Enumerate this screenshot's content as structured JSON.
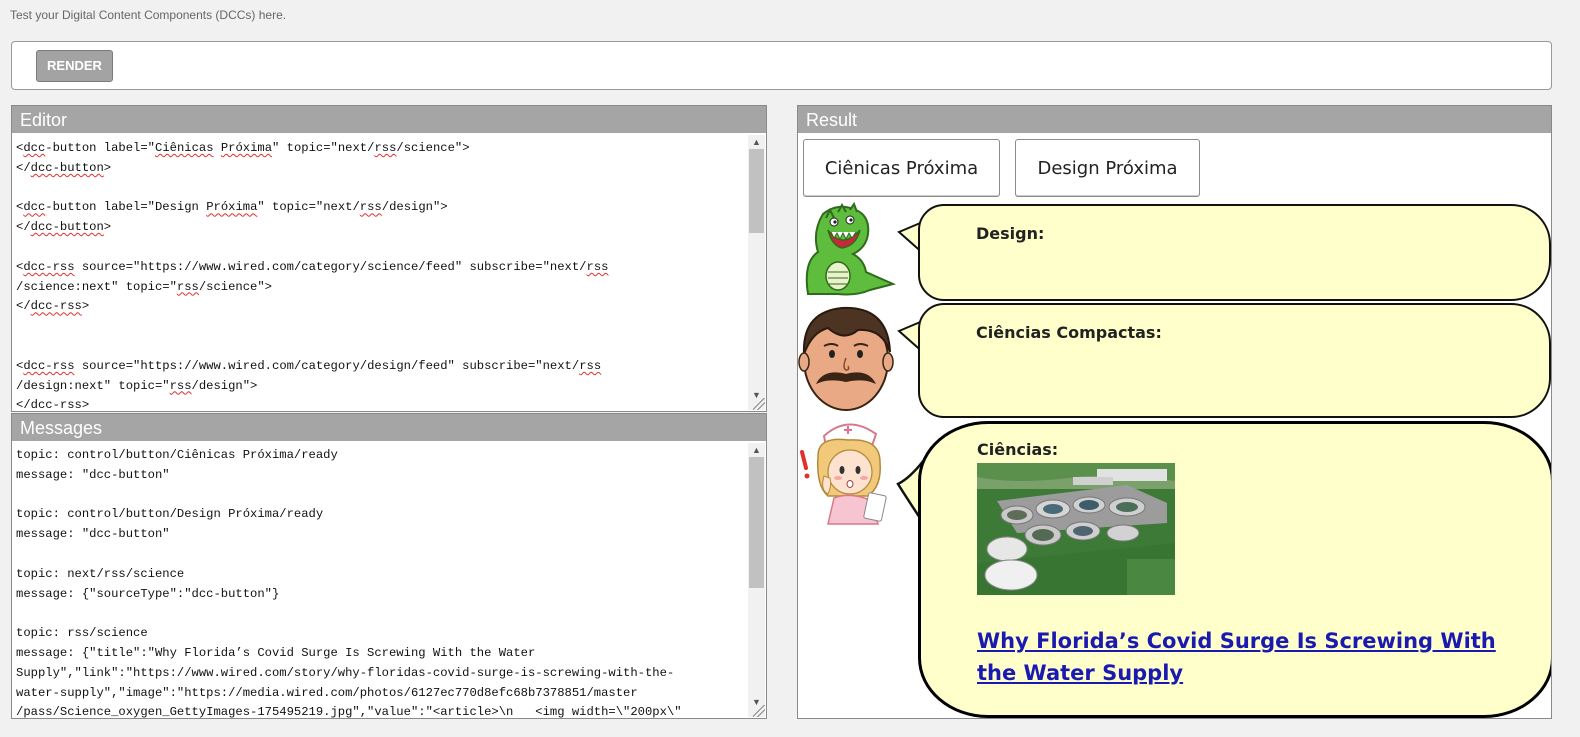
{
  "intro_text": "Test your Digital Content Components (DCCs) here.",
  "toolbar": {
    "render_label": "RENDER"
  },
  "editor": {
    "title": "Editor",
    "lines": [
      [
        {
          "t": "<"
        },
        {
          "t": "dcc",
          "s": 1
        },
        {
          "t": "-button label=\""
        },
        {
          "t": "Ciênicas",
          "s": 1
        },
        {
          "t": " "
        },
        {
          "t": "Próxima",
          "s": 1
        },
        {
          "t": "\" topic=\"next/"
        },
        {
          "t": "rss",
          "s": 1
        },
        {
          "t": "/science\">"
        }
      ],
      [
        {
          "t": "</"
        },
        {
          "t": "dcc-button",
          "s": 1
        },
        {
          "t": ">"
        }
      ],
      [],
      [
        {
          "t": "<"
        },
        {
          "t": "dcc",
          "s": 1
        },
        {
          "t": "-button label=\"Design "
        },
        {
          "t": "Próxima",
          "s": 1
        },
        {
          "t": "\" topic=\"next/"
        },
        {
          "t": "rss",
          "s": 1
        },
        {
          "t": "/design\">"
        }
      ],
      [
        {
          "t": "</"
        },
        {
          "t": "dcc-button",
          "s": 1
        },
        {
          "t": ">"
        }
      ],
      [],
      [
        {
          "t": "<"
        },
        {
          "t": "dcc-rss",
          "s": 1
        },
        {
          "t": " source=\"https://www.wired.com/category/science/feed\" subscribe=\"next/"
        },
        {
          "t": "rss",
          "s": 1
        }
      ],
      [
        {
          "t": "/science:next\" topic=\""
        },
        {
          "t": "rss",
          "s": 1
        },
        {
          "t": "/science\">"
        }
      ],
      [
        {
          "t": "</"
        },
        {
          "t": "dcc-rss",
          "s": 1
        },
        {
          "t": ">"
        }
      ],
      [],
      [],
      [
        {
          "t": "<"
        },
        {
          "t": "dcc-rss",
          "s": 1
        },
        {
          "t": " source=\"https://www.wired.com/category/design/feed\" subscribe=\"next/"
        },
        {
          "t": "rss",
          "s": 1
        }
      ],
      [
        {
          "t": "/design:next\" topic=\""
        },
        {
          "t": "rss",
          "s": 1
        },
        {
          "t": "/design\">"
        }
      ],
      [
        {
          "t": "</"
        },
        {
          "t": "dcc-rss",
          "s": 1
        },
        {
          "t": ">"
        }
      ]
    ],
    "scroll_position": 0.0,
    "scroll_visible_fraction": 0.35
  },
  "messages": {
    "title": "Messages",
    "lines": [
      "topic: control/button/Ciênicas Próxima/ready",
      "message: \"dcc-button\"",
      "",
      "topic: control/button/Design Próxima/ready",
      "message: \"dcc-button\"",
      "",
      "topic: next/rss/science",
      "message: {\"sourceType\":\"dcc-button\"}",
      "",
      "topic: rss/science",
      "message: {\"title\":\"Why Florida’s Covid Surge Is Screwing With the Water",
      "Supply\",\"link\":\"https://www.wired.com/story/why-floridas-covid-surge-is-screwing-with-the-",
      "water-supply\",\"image\":\"https://media.wired.com/photos/6127ec770d8efc68b7378851/master",
      "/pass/Science_oxygen_GettyImages-175495219.jpg\",\"value\":\"<article>\\n   <img width=\\\"200px\\\""
    ],
    "scroll_position": 0.0,
    "scroll_visible_fraction": 0.55
  },
  "result": {
    "title": "Result",
    "buttons": [
      "Ciênicas Próxima",
      "Design Próxima"
    ],
    "bubbles": [
      {
        "title": "Design:",
        "avatar": "dinosaur-icon"
      },
      {
        "title": "Ciências Compactas:",
        "avatar": "mustache-man-icon"
      },
      {
        "title": "Ciências:",
        "avatar": "nurse-icon"
      }
    ],
    "news": {
      "link_text": "Why Florida’s Covid Surge Is Screwing With the Water Supply",
      "image": "water-treatment-plant-photo"
    }
  },
  "colors": {
    "panel_header": "#a5a5a5",
    "bubble_fill": "#ffffcc",
    "link": "#1a1ab0",
    "render_button": "#a3a3a3"
  }
}
